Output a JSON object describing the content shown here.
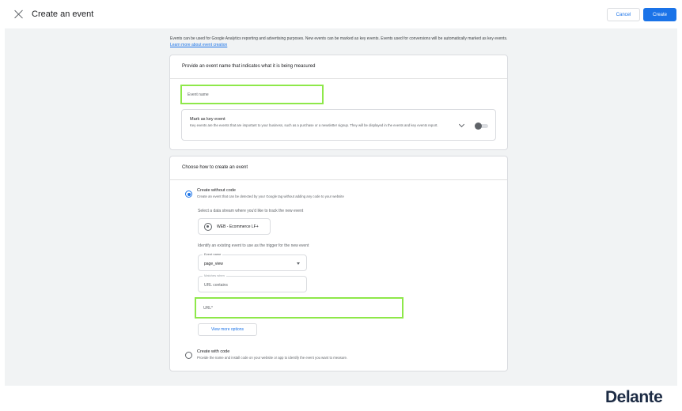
{
  "header": {
    "title": "Create an event",
    "cancel_label": "Cancel",
    "create_label": "Create"
  },
  "intro": {
    "text": "Events can be used for Google Analytics reporting and advertising purposes. New events can be marked as key events. Events used for conversions will be automatically marked as key events.",
    "link": "Learn more about event creation"
  },
  "name_card": {
    "heading": "Provide an event name that indicates what it is being measured",
    "event_name_placeholder": "Event name",
    "key_event": {
      "title": "Mark as key event",
      "description": "Key events are the events that are important to your business, such as a purchase or a newsletter signup. They will be displayed in the events and key events report."
    }
  },
  "method_card": {
    "heading": "Choose how to create an event",
    "without_code": {
      "title": "Create without code",
      "description": "Create an event that can be detected by your Google tag without adding any code to your website",
      "stream_label": "Select a data stream where you'd like to track the new event",
      "stream_value": "WEB - Ecommerce LF+",
      "trigger_label": "Identify an existing event to use as the trigger for the new event",
      "event_select": {
        "legend": "Event name",
        "value": "page_view"
      },
      "match_select": {
        "legend": "Matches when",
        "value": "URL contains"
      },
      "url_placeholder": "URL*",
      "more_options": "View more options"
    },
    "with_code": {
      "title": "Create with code",
      "description": "Provide the name and install code on your website or app to identify the event you want to measure."
    }
  },
  "watermark": "Delante",
  "colors": {
    "primary": "#1a73e8",
    "highlight": "#8ee84a"
  }
}
